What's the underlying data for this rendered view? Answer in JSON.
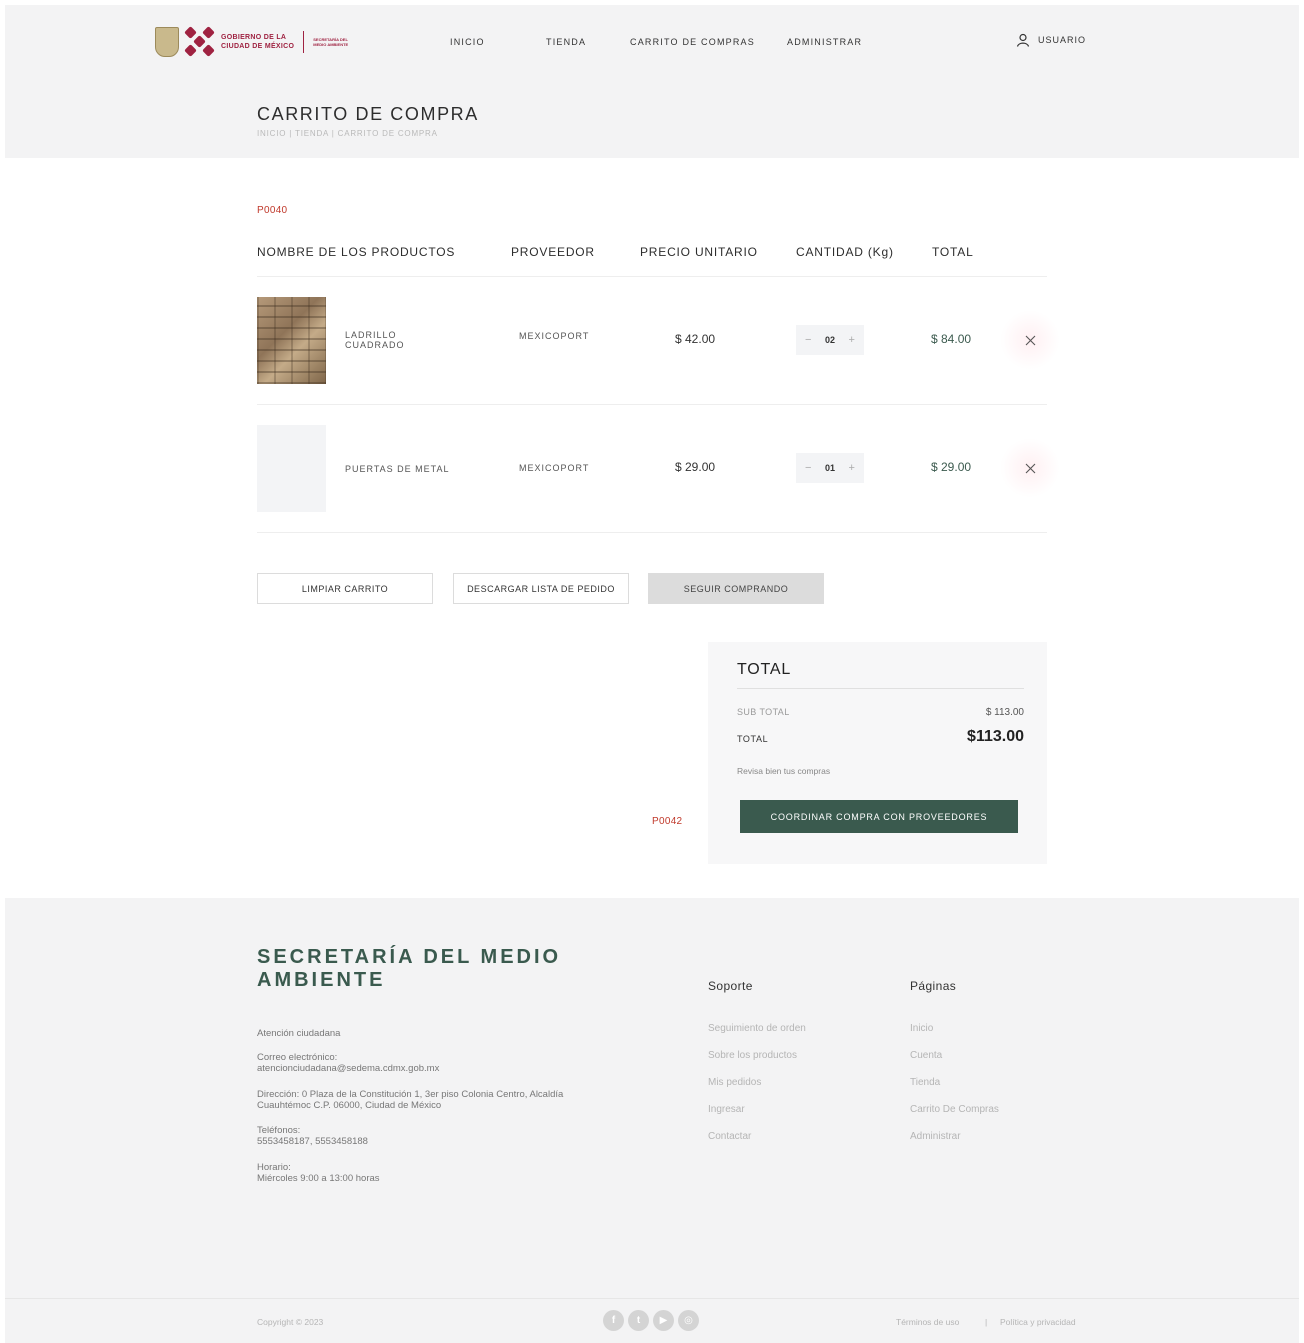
{
  "header": {
    "logo": {
      "line1": "GOBIERNO DE LA",
      "line2": "CIUDAD DE MÉXICO",
      "secretaria": "SECRETARÍA DEL MEDIO AMBIENTE"
    },
    "nav": [
      "INICIO",
      "TIENDA",
      "CARRITO DE COMPRAS",
      "ADMINISTRAR"
    ],
    "user_label": "USUARIO"
  },
  "page": {
    "title": "CARRITO DE COMPRA",
    "breadcrumb": "INICIO  |  TIENDA  |  CARRITO DE COMPRA"
  },
  "codes": {
    "top": "P0040",
    "bottom": "P0042"
  },
  "table": {
    "headers": [
      "NOMBRE DE LOS PRODUCTOS",
      "PROVEEDOR",
      "PRECIO UNITARIO",
      "CANTIDAD (Kg)",
      "TOTAL"
    ],
    "rows": [
      {
        "name": "LADRILLO CUADRADO",
        "provider": "MEXICOPORT",
        "price": "$ 42.00",
        "qty": "02",
        "total": "$ 84.00",
        "image": "brick-texture"
      },
      {
        "name": "PUERTAS DE METAL",
        "provider": "MEXICOPORT",
        "price": "$ 29.00",
        "qty": "01",
        "total": "$ 29.00",
        "image": "blank"
      }
    ],
    "minus": "−",
    "plus": "+"
  },
  "actions": {
    "clear": "LIMPIAR CARRITO",
    "download": "DESCARGAR LISTA DE PEDIDO",
    "continue": "SEGUIR COMPRANDO"
  },
  "summary": {
    "title": "TOTAL",
    "subtotal_label": "SUB TOTAL",
    "subtotal_value": "$ 113.00",
    "total_label": "TOTAL",
    "total_value": "$113.00",
    "note": "Revisa bien tus compras",
    "button": "COORDINAR COMPRA CON PROVEEDORES"
  },
  "footer": {
    "brand": "SECRETARÍA DEL MEDIO AMBIENTE",
    "attention": "Atención ciudadana",
    "email_label": "Correo electrónico:",
    "email": "atencionciudadana@sedema.cdmx.gob.mx",
    "address": "Dirección: 0 Plaza de la Constitución 1, 3er piso Colonia Centro, Alcaldía Cuauhtémoc C.P. 06000, Ciudad de México",
    "phones_label": "Teléfonos:",
    "phones": "5553458187, 5553458188",
    "hours_label": "Horario:",
    "hours": "Miércoles 9:00 a 13:00 horas",
    "support_title": "Soporte",
    "support_links": [
      "Seguimiento de orden",
      "Sobre los productos",
      "Mis pedidos",
      "Ingresar",
      "Contactar"
    ],
    "pages_title": "Páginas",
    "pages_links": [
      "Inicio",
      "Cuenta",
      "Tienda",
      "Carrito De Compras",
      "Administrar"
    ],
    "copyright": "Copyright © 2023",
    "terms": "Términos de uso",
    "separator": "|",
    "privacy": "Política y privacidad",
    "social": [
      "facebook-icon",
      "twitter-icon",
      "youtube-icon",
      "instagram-icon"
    ]
  },
  "colors": {
    "accent_green": "#3a5a4e",
    "brand_red": "#9f2241",
    "code_red": "#c0392b"
  }
}
